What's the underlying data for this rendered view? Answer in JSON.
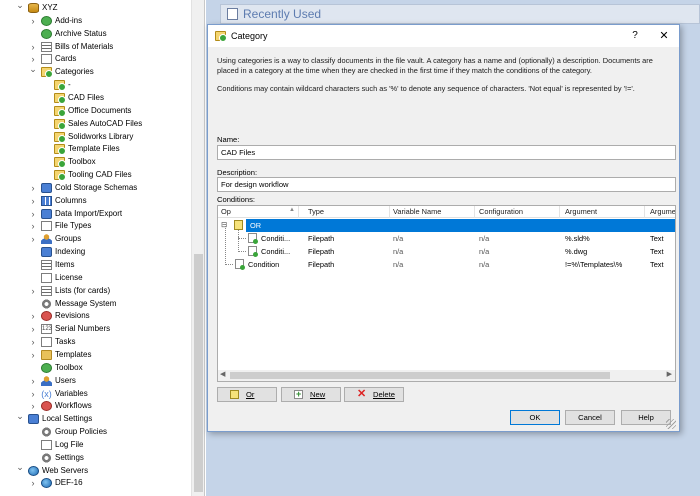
{
  "tree": {
    "items": [
      {
        "label": "XYZ",
        "icon": "database-icon",
        "chev": "v"
      },
      {
        "label": "Add-ins",
        "icon": "puzzle-icon",
        "chev": ">"
      },
      {
        "label": "Archive Status",
        "icon": "archive-icon",
        "chev": ""
      },
      {
        "label": "Bills of Materials",
        "icon": "bom-icon",
        "chev": ">"
      },
      {
        "label": "Cards",
        "icon": "card-icon",
        "chev": ">"
      },
      {
        "label": "Categories",
        "icon": "categories-icon",
        "chev": "v"
      },
      {
        "label": "-",
        "icon": "category-icon",
        "chev": ""
      },
      {
        "label": "CAD Files",
        "icon": "category-icon",
        "chev": ""
      },
      {
        "label": "Office Documents",
        "icon": "category-icon",
        "chev": ""
      },
      {
        "label": "Sales AutoCAD Files",
        "icon": "category-icon",
        "chev": ""
      },
      {
        "label": "Solidworks Library",
        "icon": "category-icon",
        "chev": ""
      },
      {
        "label": "Template Files",
        "icon": "category-icon",
        "chev": ""
      },
      {
        "label": "Toolbox",
        "icon": "category-icon",
        "chev": ""
      },
      {
        "label": "Tooling CAD Files",
        "icon": "category-icon",
        "chev": ""
      },
      {
        "label": "Cold Storage Schemas",
        "icon": "cold-storage-icon",
        "chev": ">"
      },
      {
        "label": "Columns",
        "icon": "columns-icon",
        "chev": ">"
      },
      {
        "label": "Data Import/Export",
        "icon": "import-export-icon",
        "chev": ">"
      },
      {
        "label": "File Types",
        "icon": "file-types-icon",
        "chev": ">"
      },
      {
        "label": "Groups",
        "icon": "groups-icon",
        "chev": ">"
      },
      {
        "label": "Indexing",
        "icon": "indexing-icon",
        "chev": ""
      },
      {
        "label": "Items",
        "icon": "items-icon",
        "chev": ""
      },
      {
        "label": "License",
        "icon": "license-icon",
        "chev": ""
      },
      {
        "label": "Lists (for cards)",
        "icon": "lists-icon",
        "chev": ">"
      },
      {
        "label": "Message System",
        "icon": "message-icon",
        "chev": ""
      },
      {
        "label": "Revisions",
        "icon": "revisions-icon",
        "chev": ">"
      },
      {
        "label": "Serial Numbers",
        "icon": "serial-numbers-icon",
        "chev": ">"
      },
      {
        "label": "Tasks",
        "icon": "tasks-icon",
        "chev": ">"
      },
      {
        "label": "Templates",
        "icon": "templates-icon",
        "chev": ">"
      },
      {
        "label": "Toolbox",
        "icon": "toolbox-icon",
        "chev": ""
      },
      {
        "label": "Users",
        "icon": "users-icon",
        "chev": ">"
      },
      {
        "label": "Variables",
        "icon": "variables-icon",
        "chev": ">"
      },
      {
        "label": "Workflows",
        "icon": "workflows-icon",
        "chev": ">"
      },
      {
        "label": "Local Settings",
        "icon": "local-settings-icon",
        "chev": "v"
      },
      {
        "label": "Group Policies",
        "icon": "group-policies-icon",
        "chev": ""
      },
      {
        "label": "Log File",
        "icon": "log-file-icon",
        "chev": ""
      },
      {
        "label": "Settings",
        "icon": "settings-icon",
        "chev": ""
      },
      {
        "label": "Web Servers",
        "icon": "web-servers-icon",
        "chev": "v"
      },
      {
        "label": "DEF-16",
        "icon": "globe-icon",
        "chev": ">"
      }
    ]
  },
  "background": {
    "title": "Recently Used"
  },
  "dialog": {
    "title": "Category",
    "help_glyph": "?",
    "close_glyph": "✕",
    "description": "Using categories is a way to classify documents in the file vault. A category has a name and (optionally) a description. Documents are placed in a category at the time when they are checked in the first time if they match the conditions of the category.",
    "wildcard_note": "Conditions may contain wildcard characters such as '%' to denote any sequence of characters. 'Not equal' is represented by '!='.",
    "name_label": "Name:",
    "name_value": "CAD Files",
    "description_label": "Description:",
    "description_value": "For design workflow",
    "conditions_label": "Conditions:",
    "grid": {
      "columns": [
        "Op",
        "Type",
        "Variable Name",
        "Configuration",
        "Argument",
        "Argume"
      ],
      "rows": [
        {
          "op": "OR",
          "type": "",
          "variable": "",
          "configuration": "",
          "argument": "",
          "argument_type": "",
          "selected": true
        },
        {
          "op": "Conditi...",
          "type": "Filepath",
          "variable": "n/a",
          "configuration": "n/a",
          "argument": "%.sld%",
          "argument_type": "Text",
          "selected": false
        },
        {
          "op": "Conditi...",
          "type": "Filepath",
          "variable": "n/a",
          "configuration": "n/a",
          "argument": "%.dwg",
          "argument_type": "Text",
          "selected": false
        },
        {
          "op": "Condition",
          "type": "Filepath",
          "variable": "n/a",
          "configuration": "n/a",
          "argument": "!=%\\Templates\\%",
          "argument_type": "Text",
          "selected": false
        }
      ]
    },
    "buttons": {
      "or": "Or",
      "new": "New",
      "delete": "Delete",
      "ok": "OK",
      "cancel": "Cancel",
      "help": "Help"
    }
  }
}
